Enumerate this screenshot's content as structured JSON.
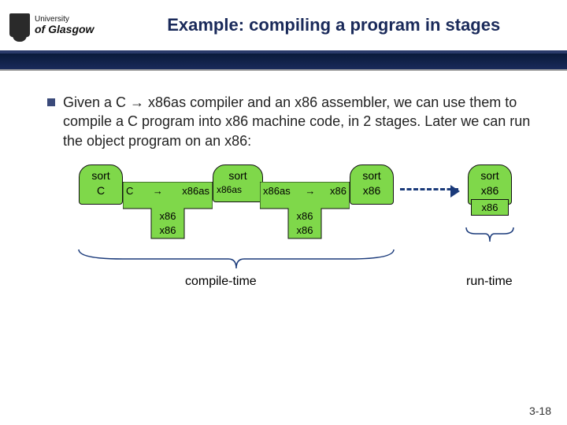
{
  "header": {
    "logo_line1": "University",
    "logo_line2": "of Glasgow",
    "title": "Example: compiling a program in stages"
  },
  "bullet_text": "Given a C → x86as compiler and an x86 assembler, we can use them to compile a C program into x86 machine code, in 2 stages. Later we can run the object program on an x86:",
  "diagram": {
    "prog1": {
      "name": "sort",
      "lang": "C"
    },
    "prog2": {
      "name": "sort",
      "lang1": "x86as",
      "lang2": "x86as"
    },
    "prog3": {
      "name": "sort",
      "lang": "x86"
    },
    "prog4": {
      "name": "sort",
      "lang": "x86"
    },
    "compiler": {
      "from": "C",
      "to": "x86as",
      "impl": "x86",
      "machine": "x86"
    },
    "assembler": {
      "from": "x86as",
      "to": "x86",
      "impl": "x86",
      "machine": "x86"
    },
    "run_machine": "x86",
    "brace_left": "compile-time",
    "brace_right": "run-time"
  },
  "footer": "3-18"
}
